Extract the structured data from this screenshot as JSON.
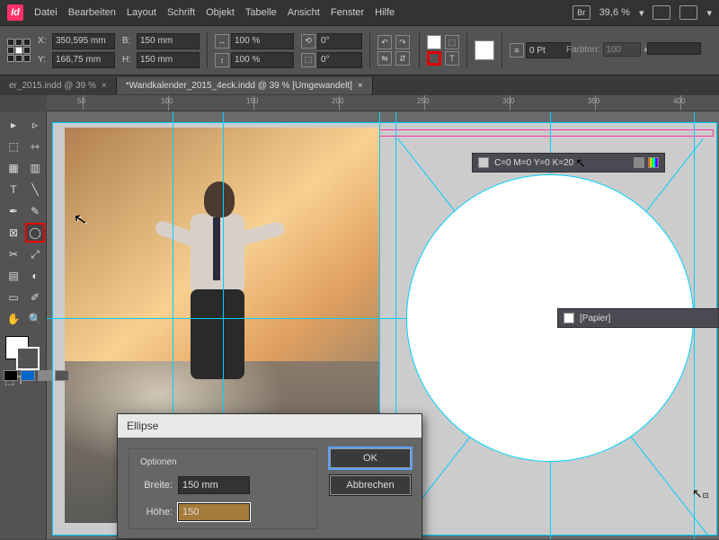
{
  "logo": "Id",
  "menu": {
    "file": "Datei",
    "edit": "Bearbeiten",
    "layout": "Layout",
    "type": "Schrift",
    "object": "Objekt",
    "table": "Tabelle",
    "view": "Ansicht",
    "window": "Fenster",
    "help": "Hilfe"
  },
  "topright": {
    "br": "Br",
    "zoom": "39,6 %"
  },
  "control": {
    "x": "350,595 mm",
    "y": "166,75 mm",
    "w_lbl": "B:",
    "w": "150 mm",
    "h_lbl": "H:",
    "h": "150 mm",
    "scale1": "100 %",
    "scale2": "100 %",
    "rot": "0°",
    "shear": "0°",
    "stroke": "0 Pt"
  },
  "farbton": {
    "label": "Farbton:",
    "value": "100"
  },
  "tabs": {
    "t1": "er_2015.indd @ 39 %",
    "t1x": "×",
    "t2": "*Wandkalender_2015_4eck.indd @ 39 % [Umgewandelt]",
    "t2x": "×"
  },
  "ruler": {
    "m50": "50",
    "m100": "100",
    "m150": "150",
    "m200": "200",
    "m250": "250",
    "m300": "300",
    "m350": "350",
    "m400": "400"
  },
  "swatch_tip": {
    "text": "C=0 M=0 Y=0 K=20"
  },
  "paper_tip": {
    "text": "[Papier]"
  },
  "dialog": {
    "title": "Ellipse",
    "legend": "Optionen",
    "width_lbl": "Breite:",
    "width_val": "150 mm",
    "height_lbl": "Höhe:",
    "height_val": "150",
    "ok": "OK",
    "cancel": "Abbrechen"
  }
}
